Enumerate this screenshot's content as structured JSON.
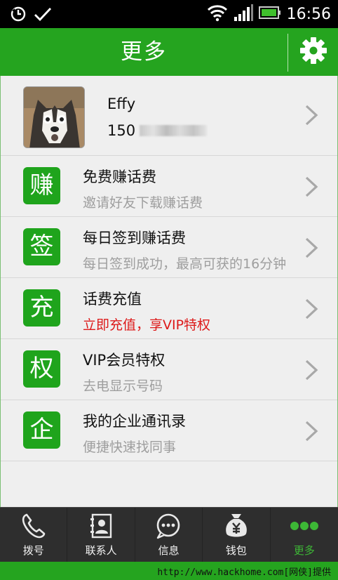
{
  "status_bar": {
    "time": "16:56",
    "icons": [
      "sync-icon",
      "check-icon",
      "wifi-icon",
      "signal-icon",
      "battery-icon"
    ]
  },
  "header": {
    "title": "更多",
    "settings_icon": "gear-icon"
  },
  "profile": {
    "name": "Effy",
    "phone_prefix": "150"
  },
  "menu": [
    {
      "badge": "赚",
      "title": "免费赚话费",
      "subtitle": "邀请好友下载赚话费",
      "highlight": false
    },
    {
      "badge": "签",
      "title": "每日签到赚话费",
      "subtitle": "每日签到成功，最高可获的16分钟",
      "highlight": false
    },
    {
      "badge": "充",
      "title": "话费充值",
      "subtitle": "立即充值，享VIP特权",
      "highlight": true
    },
    {
      "badge": "权",
      "title": "VIP会员特权",
      "subtitle": "去电显示号码",
      "highlight": false
    },
    {
      "badge": "企",
      "title": "我的企业通讯录",
      "subtitle": "便捷快速找同事",
      "highlight": false
    }
  ],
  "tabs": [
    {
      "label": "拨号",
      "icon": "phone-icon",
      "active": false
    },
    {
      "label": "联系人",
      "icon": "contacts-icon",
      "active": false
    },
    {
      "label": "信息",
      "icon": "message-icon",
      "active": false
    },
    {
      "label": "钱包",
      "icon": "wallet-icon",
      "active": false
    },
    {
      "label": "更多",
      "icon": "more-icon",
      "active": true
    }
  ],
  "footer": {
    "text": "http://www.hackhome.com[网侠]提供"
  },
  "colors": {
    "brand_green": "#25a41f",
    "highlight_red": "#dd1a1a",
    "tab_active": "#3db736"
  }
}
